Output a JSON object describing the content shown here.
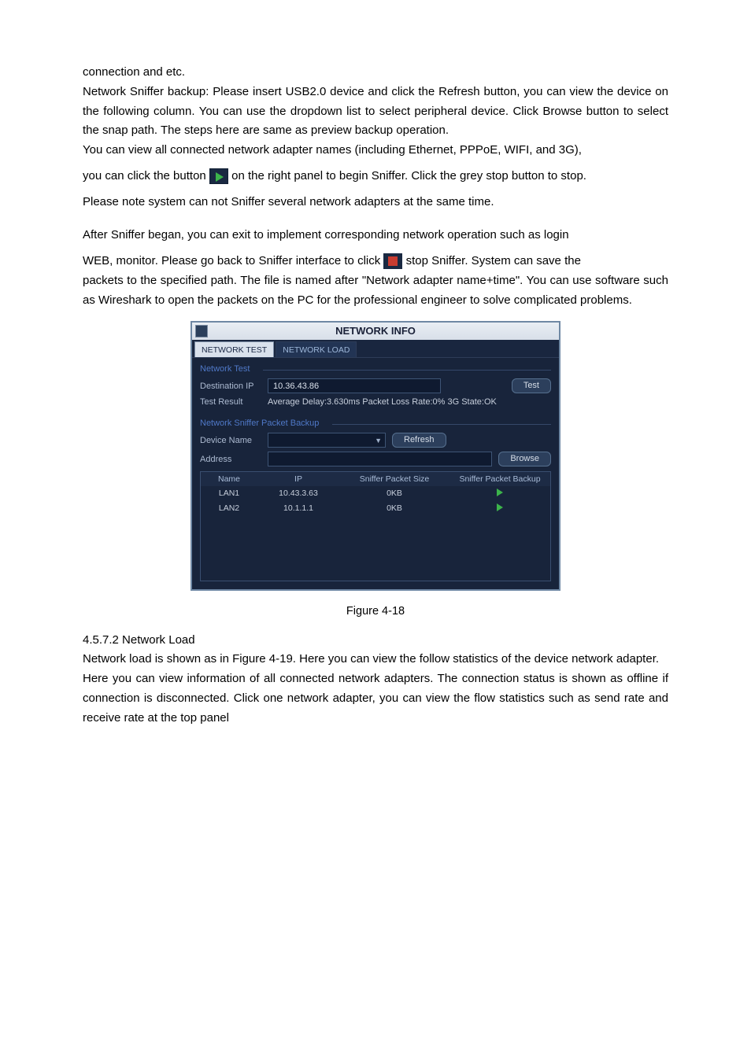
{
  "doc": {
    "p1": "connection and etc.",
    "p2": "Network Sniffer backup: Please insert USB2.0 device and click the Refresh button, you can view the device on the following column. You can use the dropdown list to select peripheral device. Click Browse button to select the snap path. The steps here are same as preview backup operation.",
    "p3": "You can view all connected network adapter names (including Ethernet, PPPoE, WIFI, and 3G),",
    "p4a": "you can click the button ",
    "p4b": " on the right panel to begin Sniffer. Click the grey stop button to stop.",
    "p5": "Please note system can not Sniffer several network adapters at the same time.",
    "p6": "After Sniffer began, you can exit to implement corresponding network operation such as login",
    "p7a": "WEB, monitor. Please go back to Sniffer interface to click ",
    "p7b": " stop Sniffer. System can save the",
    "p8": "packets to the specified path. The file is named after \"Network adapter name+time\". You can use software such as Wireshark to open the packets on the PC for the professional engineer to solve complicated problems.",
    "figure_caption": "Figure 4-18",
    "sub_section_number": "4.5.7.2",
    "sub_section_title": "Network Load",
    "p9": "Network load is shown as in Figure 4-19. Here you can view the follow statistics of the device network adapter.",
    "p10": "Here you can view information of all connected network adapters. The connection status is shown as offline if connection is disconnected. Click one network adapter, you can view the flow statistics such as send rate and receive rate at the top panel"
  },
  "ui": {
    "window_title": "NETWORK INFO",
    "tabs": {
      "test": "NETWORK TEST",
      "load": "NETWORK LOAD"
    },
    "section_network_test": "Network Test",
    "destination_ip_label": "Destination IP",
    "destination_ip_value": "10.36.43.86",
    "test_button": "Test",
    "test_result_label": "Test Result",
    "test_result_value": "Average Delay:3.630ms  Packet Loss Rate:0%  3G State:OK",
    "section_sniffer_backup": "Network Sniffer Packet Backup",
    "device_name_label": "Device Name",
    "refresh_button": "Refresh",
    "address_label": "Address",
    "browse_button": "Browse",
    "columns": {
      "name": "Name",
      "ip": "IP",
      "size": "Sniffer Packet Size",
      "backup": "Sniffer Packet Backup"
    },
    "rows": [
      {
        "name": "LAN1",
        "ip": "10.43.3.63",
        "size": "0KB"
      },
      {
        "name": "LAN2",
        "ip": "10.1.1.1",
        "size": "0KB"
      }
    ]
  }
}
